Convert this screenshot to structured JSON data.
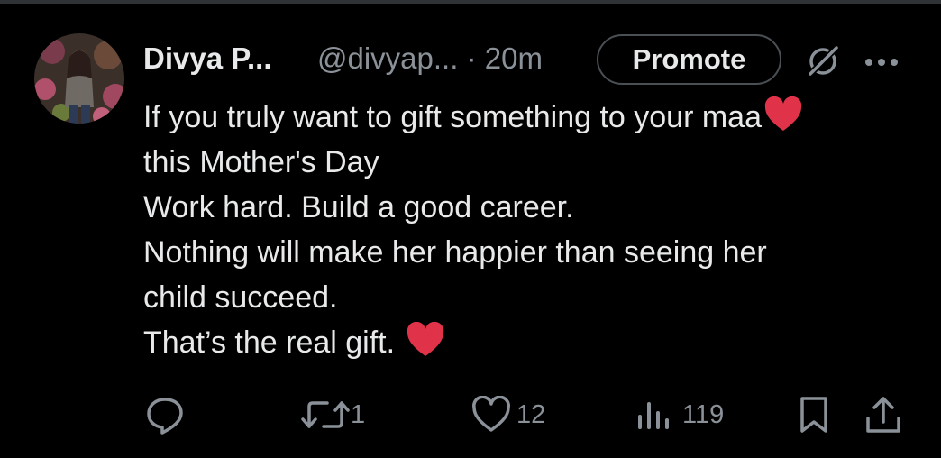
{
  "tweet": {
    "author_name": "Divya P...",
    "handle": "@divyap...",
    "timestamp": "· 20m",
    "promote_label": "Promote",
    "text_lines": [
      "If you truly want to gift something to your maa",
      "this Mother's Day",
      "Work hard. Build a good career.",
      "Nothing will make her happier than seeing her",
      "child succeed.",
      "That’s the real gift. "
    ],
    "emoji": "red-heart"
  },
  "actions": {
    "reply_count": "",
    "retweet_count": "1",
    "like_count": "12",
    "views_count": "119"
  },
  "icons": [
    "grok-icon",
    "more-icon",
    "reply-icon",
    "retweet-icon",
    "like-icon",
    "views-icon",
    "bookmark-icon",
    "share-icon"
  ],
  "colors": {
    "background": "#000000",
    "text": "#e7e9ea",
    "secondary_text": "#8b9198",
    "heart": "#e0334a"
  }
}
